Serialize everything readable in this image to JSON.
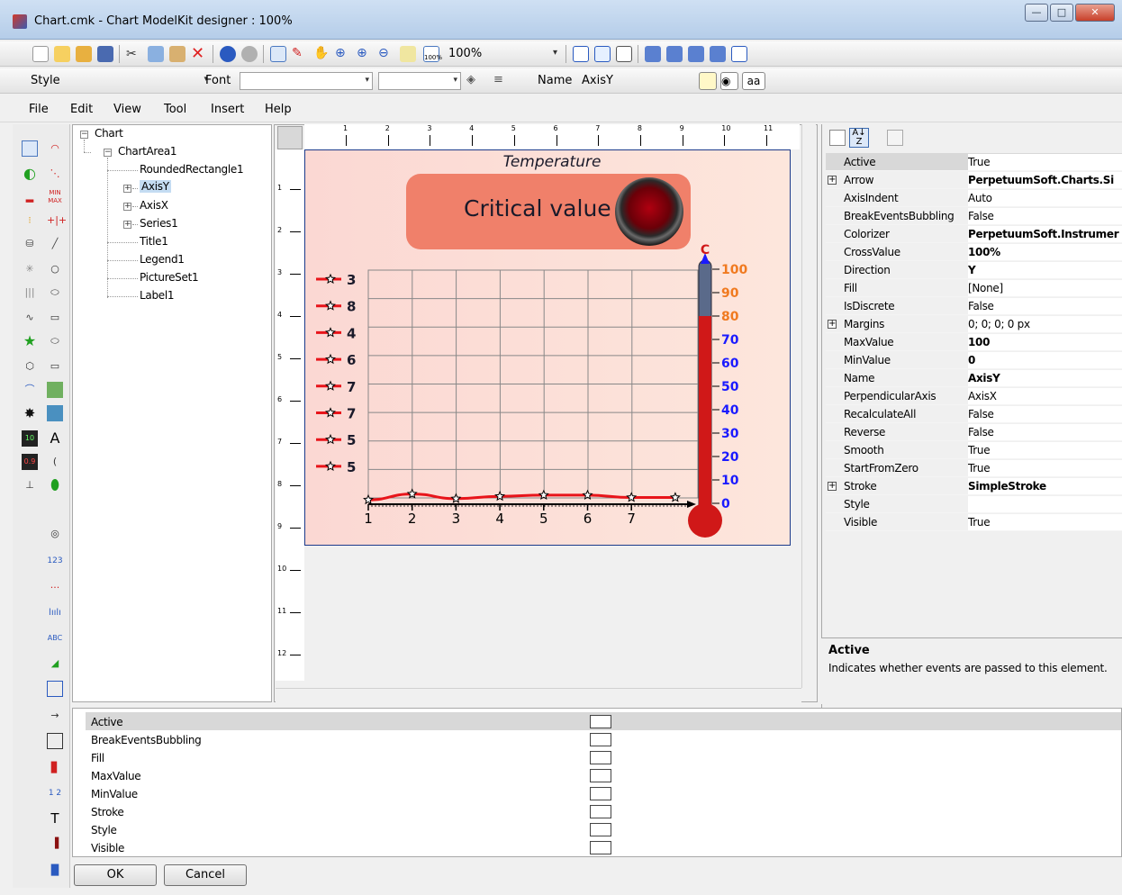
{
  "window": {
    "title": "Chart.cmk - Chart ModelKit designer : 100%"
  },
  "toolbar": {
    "zoom_value": "100%",
    "style_label": "Style",
    "font_label": "Font",
    "name_label": "Name",
    "name_value": "AxisY",
    "aa_label": "aa"
  },
  "menu": [
    "File",
    "Edit",
    "View",
    "Tool",
    "Insert",
    "Help"
  ],
  "tree": {
    "items": [
      "Chart",
      "ChartArea1",
      "RoundedRectangle1",
      "AxisY",
      "AxisX",
      "Series1",
      "Title1",
      "Legend1",
      "PictureSet1",
      "Label1"
    ],
    "selected": "AxisY"
  },
  "ruler": {
    "top": [
      "1",
      "2",
      "3",
      "4",
      "5",
      "6",
      "7",
      "8",
      "9",
      "10",
      "11"
    ],
    "left": [
      "1",
      "2",
      "3",
      "4",
      "5",
      "6",
      "7",
      "8",
      "9",
      "10",
      "11",
      "12"
    ]
  },
  "chart": {
    "title": "Temperature",
    "banner": "Critical value",
    "unit": "C",
    "x_ticks": [
      "1",
      "2",
      "3",
      "4",
      "5",
      "6",
      "7"
    ],
    "y_ticks": [
      "100",
      "90",
      "80",
      "70",
      "60",
      "50",
      "40",
      "30",
      "20",
      "10",
      "0"
    ],
    "legend": [
      "3",
      "8",
      "4",
      "6",
      "7",
      "7",
      "5",
      "5"
    ],
    "colors": {
      "line": "#e8141a",
      "accent": "#1a1aff",
      "axis_orange": "#f07a20"
    }
  },
  "chart_data": {
    "type": "line",
    "title": "Temperature",
    "x": [
      1,
      2,
      3,
      4,
      5,
      6,
      7,
      8
    ],
    "series": [
      {
        "values": [
          3,
          8,
          4,
          6,
          7,
          7,
          5,
          5
        ]
      }
    ],
    "ylim": [
      0,
      100
    ],
    "thermometer": {
      "unit": "C",
      "range": [
        0,
        100
      ],
      "value": 80
    }
  },
  "properties": [
    {
      "name": "Active",
      "value": "True",
      "bold": false,
      "expand": false
    },
    {
      "name": "Arrow",
      "value": "PerpetuumSoft.Charts.Si",
      "bold": true,
      "expand": true
    },
    {
      "name": "AxisIndent",
      "value": "Auto",
      "bold": false,
      "expand": false
    },
    {
      "name": "BreakEventsBubbling",
      "value": "False",
      "bold": false,
      "expand": false
    },
    {
      "name": "Colorizer",
      "value": "PerpetuumSoft.Instrumer",
      "bold": true,
      "expand": false
    },
    {
      "name": "CrossValue",
      "value": "100%",
      "bold": true,
      "expand": false
    },
    {
      "name": "Direction",
      "value": "Y",
      "bold": true,
      "expand": false
    },
    {
      "name": "Fill",
      "value": "[None]",
      "bold": false,
      "expand": false
    },
    {
      "name": "IsDiscrete",
      "value": "False",
      "bold": false,
      "expand": false
    },
    {
      "name": "Margins",
      "value": "0; 0; 0; 0 px",
      "bold": false,
      "expand": true
    },
    {
      "name": "MaxValue",
      "value": "100",
      "bold": true,
      "expand": false
    },
    {
      "name": "MinValue",
      "value": "0",
      "bold": true,
      "expand": false
    },
    {
      "name": "Name",
      "value": "AxisY",
      "bold": true,
      "expand": false
    },
    {
      "name": "PerpendicularAxis",
      "value": "AxisX",
      "bold": false,
      "expand": false
    },
    {
      "name": "RecalculateAll",
      "value": "False",
      "bold": false,
      "expand": false
    },
    {
      "name": "Reverse",
      "value": "False",
      "bold": false,
      "expand": false
    },
    {
      "name": "Smooth",
      "value": "True",
      "bold": false,
      "expand": false
    },
    {
      "name": "StartFromZero",
      "value": "True",
      "bold": false,
      "expand": false
    },
    {
      "name": "Stroke",
      "value": "SimpleStroke",
      "bold": true,
      "expand": true
    },
    {
      "name": "Style",
      "value": "",
      "bold": false,
      "expand": false
    },
    {
      "name": "Visible",
      "value": "True",
      "bold": false,
      "expand": false
    }
  ],
  "description": {
    "title": "Active",
    "text": "Indicates whether events are passed to this element."
  },
  "event_list": [
    "Active",
    "BreakEventsBubbling",
    "Fill",
    "MaxValue",
    "MinValue",
    "Stroke",
    "Style",
    "Visible"
  ],
  "buttons": {
    "ok": "OK",
    "cancel": "Cancel"
  }
}
